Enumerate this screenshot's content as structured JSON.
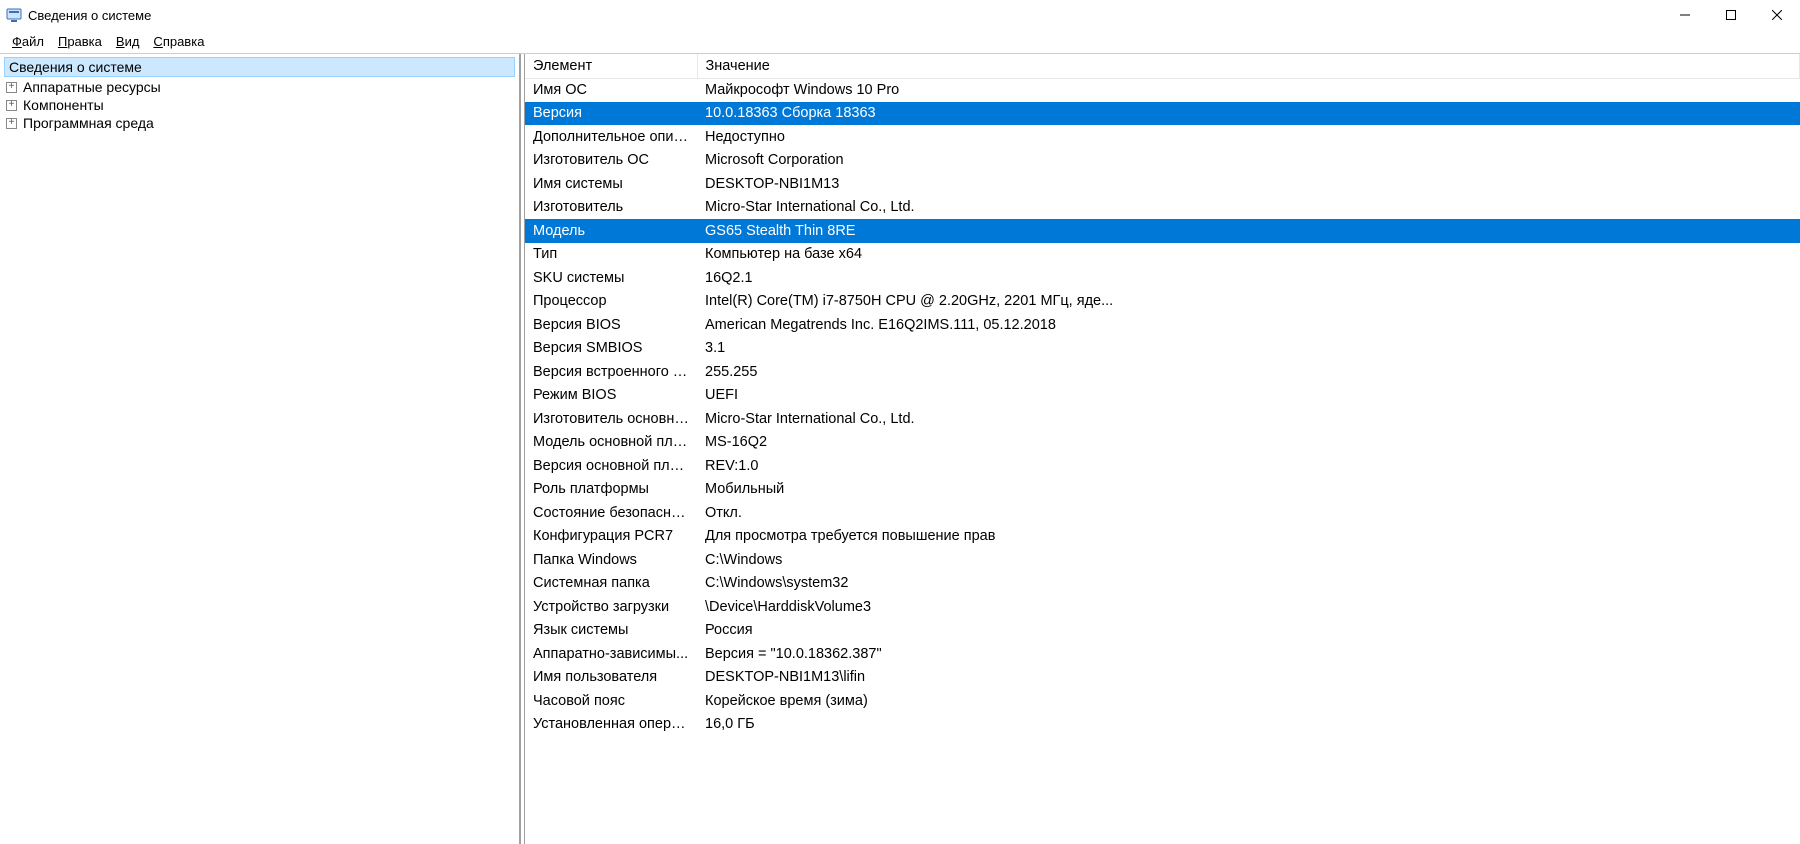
{
  "window": {
    "title": "Сведения о системе"
  },
  "menu": {
    "file": {
      "letter": "Ф",
      "rest": "айл"
    },
    "edit": {
      "letter": "П",
      "rest": "равка"
    },
    "view": {
      "letter": "В",
      "rest": "ид"
    },
    "help": {
      "letter": "С",
      "rest": "правка"
    }
  },
  "tree": {
    "root": "Сведения о системе",
    "items": [
      "Аппаратные ресурсы",
      "Компоненты",
      "Программная среда"
    ]
  },
  "columns": {
    "element": "Элемент",
    "value": "Значение"
  },
  "rows": [
    {
      "k": "Имя ОС",
      "v": "Майкрософт Windows 10 Pro",
      "sel": false
    },
    {
      "k": "Версия",
      "v": "10.0.18363 Сборка 18363",
      "sel": true
    },
    {
      "k": "Дополнительное опис...",
      "v": "Недоступно",
      "sel": false
    },
    {
      "k": "Изготовитель ОС",
      "v": "Microsoft Corporation",
      "sel": false
    },
    {
      "k": "Имя системы",
      "v": "DESKTOP-NBI1M13",
      "sel": false
    },
    {
      "k": "Изготовитель",
      "v": "Micro-Star International Co., Ltd.",
      "sel": false
    },
    {
      "k": "Модель",
      "v": "GS65 Stealth Thin 8RE",
      "sel": true
    },
    {
      "k": "Тип",
      "v": "Компьютер на базе x64",
      "sel": false
    },
    {
      "k": "SKU системы",
      "v": "16Q2.1",
      "sel": false
    },
    {
      "k": "Процессор",
      "v": "Intel(R) Core(TM) i7-8750H CPU @ 2.20GHz, 2201 МГц, яде...",
      "sel": false
    },
    {
      "k": "Версия BIOS",
      "v": "American Megatrends Inc. E16Q2IMS.111, 05.12.2018",
      "sel": false
    },
    {
      "k": "Версия SMBIOS",
      "v": "3.1",
      "sel": false
    },
    {
      "k": "Версия встроенного к...",
      "v": "255.255",
      "sel": false
    },
    {
      "k": "Режим BIOS",
      "v": "UEFI",
      "sel": false
    },
    {
      "k": "Изготовитель основно...",
      "v": "Micro-Star International Co., Ltd.",
      "sel": false
    },
    {
      "k": "Модель основной пла...",
      "v": "MS-16Q2",
      "sel": false
    },
    {
      "k": "Версия основной платы",
      "v": "REV:1.0",
      "sel": false
    },
    {
      "k": "Роль платформы",
      "v": "Мобильный",
      "sel": false
    },
    {
      "k": "Состояние безопасно...",
      "v": "Откл.",
      "sel": false
    },
    {
      "k": "Конфигурация PCR7",
      "v": "Для просмотра требуется повышение прав",
      "sel": false
    },
    {
      "k": "Папка Windows",
      "v": "C:\\Windows",
      "sel": false
    },
    {
      "k": "Системная папка",
      "v": "C:\\Windows\\system32",
      "sel": false
    },
    {
      "k": "Устройство загрузки",
      "v": "\\Device\\HarddiskVolume3",
      "sel": false
    },
    {
      "k": "Язык системы",
      "v": "Россия",
      "sel": false
    },
    {
      "k": "Аппаратно-зависимы...",
      "v": "Версия = \"10.0.18362.387\"",
      "sel": false
    },
    {
      "k": "Имя пользователя",
      "v": "DESKTOP-NBI1M13\\lifin",
      "sel": false
    },
    {
      "k": "Часовой пояс",
      "v": "Корейское время (зима)",
      "sel": false
    },
    {
      "k": "Установленная операт...",
      "v": "16,0 ГБ",
      "sel": false
    }
  ]
}
